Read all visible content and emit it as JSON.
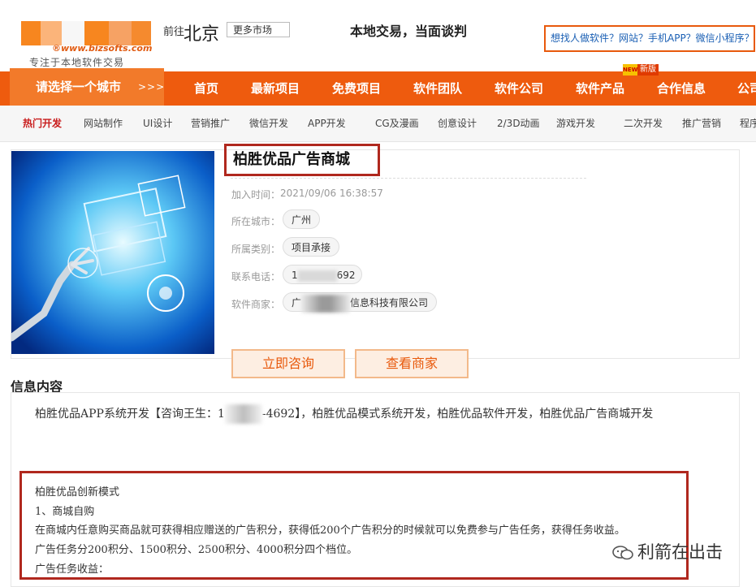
{
  "header": {
    "logo_url_text": "®www.bizsofts.com",
    "logo_slogan": "专注于本地软件交易",
    "goto_label": "前往",
    "current_city": "北京",
    "more_market": "更多市场",
    "slogan": "本地交易，当面谈判",
    "ask_link": "想找人做软件？网站？手机APP？微信小程序？"
  },
  "nav": {
    "city_select": "请选择一个城市",
    "arrows": ">>>",
    "items": [
      "首页",
      "最新项目",
      "免费项目",
      "软件团队",
      "软件公司",
      "软件产品",
      "合作信息",
      "公司"
    ],
    "badge_new": "NEW",
    "badge_label": "新版"
  },
  "subnav": {
    "items": [
      "热门开发",
      "网站制作",
      "UI设计",
      "营销推广",
      "微信开发",
      "APP开发",
      "CG及漫画",
      "创意设计",
      "2/3D动画",
      "游戏开发",
      "二次开发",
      "推广营销",
      "程序"
    ]
  },
  "product": {
    "title": "柏胜优品广告商城",
    "added_label": "加入时间：",
    "added_value": "2021/09/06 16:38:57",
    "city_label": "所在城市：",
    "city_value": "广州",
    "category_label": "所属类别：",
    "category_value": "项目承接",
    "phone_label": "联系电话：",
    "phone_prefix": "1",
    "phone_suffix": "692",
    "merchant_label": "软件商家：",
    "merchant_prefix": "广",
    "merchant_suffix": "信息科技有限公司",
    "consult_button": "立即咨询",
    "view_merchant_button": "查看商家"
  },
  "content": {
    "section_title": "信息内容",
    "intro_prefix": "柏胜优品APP系统开发【咨询王生：1",
    "intro_suffix": "-4692】，柏胜优品模式系统开发，柏胜优品软件开发，柏胜优品广告商城开发",
    "lines": [
      "柏胜优品创新模式",
      "1、商城自购",
      "在商城内任意购买商品就可获得相应赠送的广告积分，获得低200个广告积分的时候就可以免费参与广告任务，获得任务收益。",
      "广告任务分200积分、1500积分、2500积分、4000积分四个档位。",
      "广告任务收益："
    ],
    "watermark": "利箭在出击"
  },
  "colors": {
    "nav_orange": "#ee5b0e",
    "highlight_red": "#b0281e",
    "link_blue": "#1a5fb4"
  }
}
